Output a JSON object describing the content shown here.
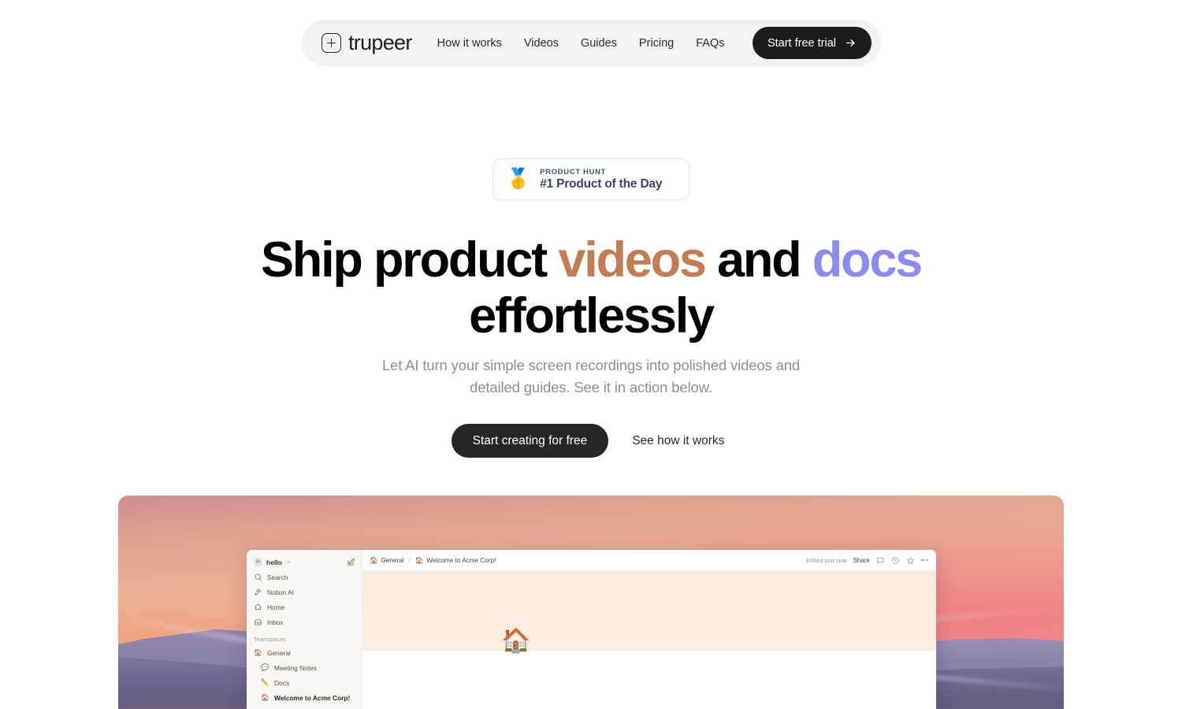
{
  "nav": {
    "brand": "trupeer",
    "brand_icon": "plus-square-icon",
    "links": [
      {
        "label": "How it works"
      },
      {
        "label": "Videos"
      },
      {
        "label": "Guides"
      },
      {
        "label": "Pricing"
      },
      {
        "label": "FAQs"
      }
    ],
    "cta": {
      "label": "Start free trial",
      "icon": "arrow-right-icon"
    }
  },
  "badge": {
    "medal": "🥇",
    "kicker": "PRODUCT HUNT",
    "title": "#1 Product of the Day"
  },
  "hero": {
    "headline": {
      "line1_part1": "Ship product ",
      "line1_highlight1": "videos",
      "line1_part2": " and ",
      "line1_highlight2": "docs",
      "line2": "effortlessly"
    },
    "subhead_line1": "Let AI turn your simple screen recordings into polished videos and",
    "subhead_line2": "detailed guides. See it in action below.",
    "cta_primary": "Start creating for free",
    "cta_secondary": "See how it works"
  },
  "app_preview": {
    "workspace": {
      "avatar_letter": "H",
      "name": "hello"
    },
    "sidebar_items": [
      {
        "label": "Search",
        "icon": "search-icon"
      },
      {
        "label": "Notion AI",
        "icon": "sparkle-icon"
      },
      {
        "label": "Home",
        "icon": "home-icon"
      },
      {
        "label": "Inbox",
        "icon": "inbox-icon"
      }
    ],
    "section_label": "Teamspaces",
    "teamspace_items": [
      {
        "label": "General",
        "emoji": "🏠",
        "selected": false
      },
      {
        "label": "Meeting Notes",
        "emoji": "💬",
        "selected": false
      },
      {
        "label": "Docs",
        "emoji": "✏️",
        "selected": false
      },
      {
        "label": "Welcome to Acme Corp!",
        "emoji": "🏠",
        "selected": true
      }
    ],
    "breadcrumb": {
      "root_emoji": "🏠",
      "root": "General",
      "separator": "/",
      "current_emoji": "🏠",
      "current": "Welcome to Acme Corp!"
    },
    "topbar": {
      "edited": "Edited just now",
      "share": "Share",
      "icons": [
        "comment-icon",
        "clock-history-icon",
        "star-icon",
        "more-options-icon"
      ]
    },
    "page_icon": "🏠"
  },
  "colors": {
    "accent_videos": "#c47c53",
    "accent_docs": "#8b8bf2",
    "cta_dark": "#262626",
    "nav_bg": "#f2f2f1"
  }
}
